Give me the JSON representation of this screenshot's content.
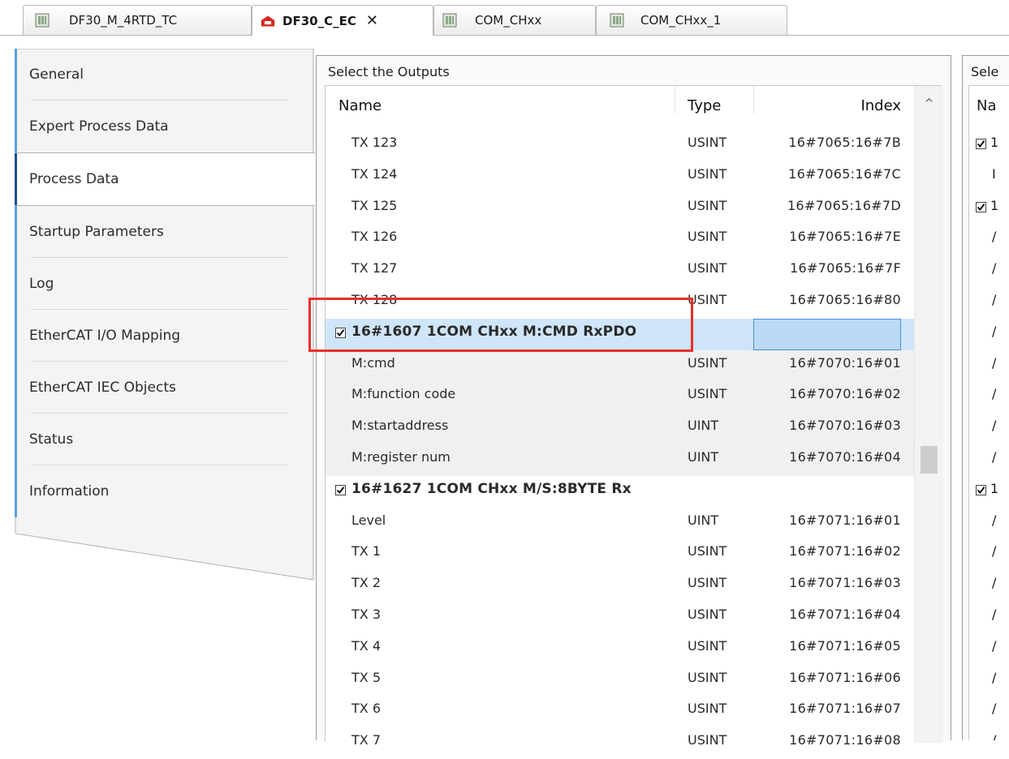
{
  "tabs": [
    {
      "label": "DF30_M_4RTD_TC",
      "icon": "device-module-icon",
      "active": false
    },
    {
      "label": "DF30_C_EC",
      "icon": "device-red-icon",
      "active": true,
      "closable": true
    },
    {
      "label": "COM_CHxx",
      "icon": "device-module-icon",
      "active": false
    },
    {
      "label": "COM_CHxx_1",
      "icon": "device-module-icon",
      "active": false
    }
  ],
  "tab_close_glyph": "✕",
  "nav": [
    {
      "label": "General"
    },
    {
      "label": "Expert Process Data"
    },
    {
      "label": "Process Data",
      "active": true
    },
    {
      "label": "Startup Parameters"
    },
    {
      "label": "Log"
    },
    {
      "label": "EtherCAT I/O Mapping"
    },
    {
      "label": "EtherCAT IEC Objects"
    },
    {
      "label": "Status"
    },
    {
      "label": "Information"
    }
  ],
  "outputs": {
    "title": "Select the Outputs",
    "columns": {
      "name": "Name",
      "type": "Type",
      "index": "Index"
    },
    "rows": [
      {
        "name": "TX 123",
        "type": "USINT",
        "index": "16#7065:16#7B"
      },
      {
        "name": "TX 124",
        "type": "USINT",
        "index": "16#7065:16#7C"
      },
      {
        "name": "TX 125",
        "type": "USINT",
        "index": "16#7065:16#7D"
      },
      {
        "name": "TX 126",
        "type": "USINT",
        "index": "16#7065:16#7E"
      },
      {
        "name": "TX 127",
        "type": "USINT",
        "index": "16#7065:16#7F"
      },
      {
        "name": "TX 128",
        "type": "USINT",
        "index": "16#7065:16#80"
      },
      {
        "name": "16#1607 1COM CHxx M:CMD  RxPDO",
        "type": "",
        "index": "",
        "group": true,
        "checked": true,
        "selected": true
      },
      {
        "name": "M:cmd",
        "type": "USINT",
        "index": "16#7070:16#01",
        "shade": true
      },
      {
        "name": "M:function code",
        "type": "USINT",
        "index": "16#7070:16#02",
        "shade": true
      },
      {
        "name": "M:startaddress",
        "type": "UINT",
        "index": "16#7070:16#03",
        "shade": true
      },
      {
        "name": "M:register num",
        "type": "UINT",
        "index": "16#7070:16#04",
        "shade": true
      },
      {
        "name": "16#1627 1COM CHxx M/S:8BYTE Rx",
        "type": "",
        "index": "",
        "group": true,
        "checked": true
      },
      {
        "name": "Level",
        "type": "UINT",
        "index": "16#7071:16#01"
      },
      {
        "name": "TX 1",
        "type": "USINT",
        "index": "16#7071:16#02"
      },
      {
        "name": "TX 2",
        "type": "USINT",
        "index": "16#7071:16#03"
      },
      {
        "name": "TX 3",
        "type": "USINT",
        "index": "16#7071:16#04"
      },
      {
        "name": "TX 4",
        "type": "USINT",
        "index": "16#7071:16#05"
      },
      {
        "name": "TX 5",
        "type": "USINT",
        "index": "16#7071:16#06"
      },
      {
        "name": "TX 6",
        "type": "USINT",
        "index": "16#7071:16#07"
      },
      {
        "name": "TX 7",
        "type": "USINT",
        "index": "16#7071:16#08"
      }
    ],
    "scroll_up_glyph": "^"
  },
  "inputs": {
    "title": "Sele",
    "column_name": "Na",
    "rows": [
      {
        "checked": true,
        "text": "1"
      },
      {
        "checked": false,
        "text": "I"
      },
      {
        "checked": true,
        "text": "1"
      },
      {
        "checked": false,
        "text": "/"
      },
      {
        "checked": false,
        "text": "/"
      },
      {
        "checked": false,
        "text": "/"
      },
      {
        "checked": false,
        "text": "/"
      },
      {
        "checked": false,
        "text": "/"
      },
      {
        "checked": false,
        "text": "/"
      },
      {
        "checked": false,
        "text": "/"
      },
      {
        "checked": false,
        "text": "/"
      },
      {
        "checked": true,
        "text": "1"
      },
      {
        "checked": false,
        "text": "/"
      },
      {
        "checked": false,
        "text": "/"
      },
      {
        "checked": false,
        "text": "/"
      },
      {
        "checked": false,
        "text": "/"
      },
      {
        "checked": false,
        "text": "/"
      },
      {
        "checked": false,
        "text": "/"
      },
      {
        "checked": false,
        "text": "/"
      },
      {
        "checked": false,
        "text": "/"
      }
    ]
  },
  "colors": {
    "highlight": "#e8302a",
    "selection": "#cfe5f9",
    "nav_accent": "#5aa1e3",
    "device_red": "#d9261c"
  }
}
